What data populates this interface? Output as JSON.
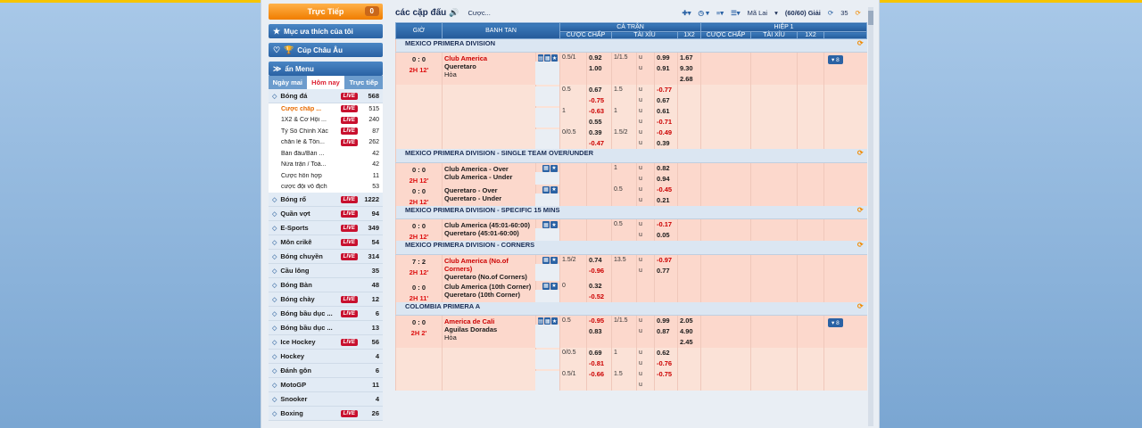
{
  "sidebar": {
    "live_label": "Trực Tiếp",
    "live_count": "0",
    "fav_label": "Mục ưa thích của tôi",
    "euro_label": "Cúp Châu Âu",
    "menu_label": "ẩn Menu",
    "tabs": [
      "Ngày mai",
      "Hôm nay",
      "Trực tiếp"
    ],
    "soccer": {
      "name": "Bóng đá",
      "count": "568"
    },
    "subs": [
      {
        "name": "Cược chấp ...",
        "count": "515",
        "live": true,
        "sel": true
      },
      {
        "name": "1X2 & Cơ Hội ...",
        "count": "240",
        "live": true
      },
      {
        "name": "Tỷ Số Chính Xác",
        "count": "87",
        "live": true
      },
      {
        "name": "chẵn lẻ & Tổn...",
        "count": "262",
        "live": true
      },
      {
        "name": "Bán đấu/Bán ...",
        "count": "42"
      },
      {
        "name": "Nửa trận / Toà...",
        "count": "42"
      },
      {
        "name": "Cược hỗn hợp",
        "count": "11"
      },
      {
        "name": "cược đội vô địch",
        "count": "53"
      }
    ],
    "sports": [
      {
        "name": "Bóng rổ",
        "count": "1222",
        "live": true
      },
      {
        "name": "Quần vợt",
        "count": "94",
        "live": true
      },
      {
        "name": "E-Sports",
        "count": "349",
        "live": true
      },
      {
        "name": "Môn crikê",
        "count": "54",
        "live": true
      },
      {
        "name": "Bóng chuyền",
        "count": "314",
        "live": true
      },
      {
        "name": "Cầu lông",
        "count": "35"
      },
      {
        "name": "Bóng Bàn",
        "count": "48"
      },
      {
        "name": "Bóng chày",
        "count": "12",
        "live": true
      },
      {
        "name": "Bóng bầu dục ...",
        "count": "6",
        "live": true
      },
      {
        "name": "Bóng bầu dục ...",
        "count": "13"
      },
      {
        "name": "Ice Hockey",
        "count": "56",
        "live": true
      },
      {
        "name": "Hockey",
        "count": "4"
      },
      {
        "name": "Đánh gôn",
        "count": "6"
      },
      {
        "name": "MotoGP",
        "count": "11"
      },
      {
        "name": "Snooker",
        "count": "4"
      },
      {
        "name": "Boxing",
        "count": "26",
        "live": true
      }
    ],
    "live_badge": "LIVE"
  },
  "header": {
    "title": "các cặp đấu",
    "bet_label": "Cược...",
    "odds_type": "Mã Lai",
    "league_count": "(60/60) Giải",
    "count_a": "35",
    "count_b": "5"
  },
  "table": {
    "col_time": "GIỜ",
    "col_team": "BANH TAN",
    "col_ft": "CẢ TRẬN",
    "col_ht": "HIỆP 1",
    "sub_hcp": "CƯỢC CHẤP",
    "sub_ou": "TÀI XỈU",
    "sub_1x2": "1X2",
    "ou_sep": "u"
  },
  "leagues": [
    {
      "name": "MEXICO PRIMERA DIVISION",
      "rows": [
        {
          "score": "0 : 0",
          "period": "2H 12'",
          "home": "Club America",
          "away": "Queretaro",
          "draw": "Hòa",
          "home_red": true,
          "hcp": "0.5/1",
          "h1": "0.92",
          "h2": "1.00",
          "ou": "1/1.5",
          "o1": "0.99",
          "o2": "0.91",
          "x1": "1.67",
          "x2": "9.30",
          "x3": "2.68",
          "more": "▾ 8"
        },
        {
          "hcp": "0.5",
          "h1": "0.67",
          "h2": "-0.75",
          "ou": "1.5",
          "o1": "-0.77",
          "o2": "0.67"
        },
        {
          "hcp": "1",
          "h1": "-0.63",
          "h2": "0.55",
          "ou": "1",
          "o1": "0.61",
          "o2": "-0.71"
        },
        {
          "hcp": "0/0.5",
          "h1": "0.39",
          "h2": "-0.47",
          "ou": "1.5/2",
          "o1": "-0.49",
          "o2": "0.39"
        }
      ]
    },
    {
      "name": "MEXICO PRIMERA DIVISION - SINGLE TEAM OVER/UNDER",
      "rows": [
        {
          "score": "0 : 0",
          "period": "2H 12'",
          "home": "Club America - Over",
          "away": "Club America - Under",
          "ou": "1",
          "o1": "0.82",
          "o2": "0.94"
        },
        {
          "score": "0 : 0",
          "period": "2H 12'",
          "home": "Queretaro - Over",
          "away": "Queretaro - Under",
          "ou": "0.5",
          "o1": "-0.45",
          "o2": "0.21"
        }
      ]
    },
    {
      "name": "MEXICO PRIMERA DIVISION - SPECIFIC 15 MINS",
      "rows": [
        {
          "score": "0 : 0",
          "period": "2H 12'",
          "home": "Club America (45:01-60:00)",
          "away": "Queretaro (45:01-60:00)",
          "ou": "0.5",
          "o1": "-0.17",
          "o2": "0.05"
        }
      ]
    },
    {
      "name": "MEXICO PRIMERA DIVISION - CORNERS",
      "rows": [
        {
          "score": "7 : 2",
          "period": "2H 12'",
          "home": "Club America (No.of Corners)",
          "away": "Queretaro (No.of Corners)",
          "home_red": true,
          "hcp": "1.5/2",
          "h1": "0.74",
          "h2": "-0.96",
          "ou": "13.5",
          "o1": "-0.97",
          "o2": "0.77"
        },
        {
          "score": "0 : 0",
          "period": "2H 11'",
          "home": "Club America (10th Corner)",
          "away": "Queretaro (10th Corner)",
          "hcp": "0",
          "h1": "0.32",
          "h2": "-0.52"
        }
      ]
    },
    {
      "name": "COLOMBIA PRIMERA A",
      "rows": [
        {
          "score": "0 : 0",
          "period": "2H 2'",
          "home": "America de Cali",
          "away": "Aguilas Doradas",
          "draw": "Hòa",
          "home_red": true,
          "hcp": "0.5",
          "h1": "-0.95",
          "h2": "0.83",
          "ou": "1/1.5",
          "o1": "0.99",
          "o2": "0.87",
          "x1": "2.05",
          "x2": "4.90",
          "x3": "2.45",
          "more": "▾ 8"
        },
        {
          "hcp": "0/0.5",
          "h1": "0.69",
          "h2": "-0.81",
          "ou": "1",
          "o1": "0.62",
          "o2": "-0.76"
        },
        {
          "hcp": "0.5/1",
          "h1": "-0.66",
          "h2": "",
          "ou": "1.5",
          "o1": "-0.75",
          "o2": ""
        }
      ]
    }
  ]
}
